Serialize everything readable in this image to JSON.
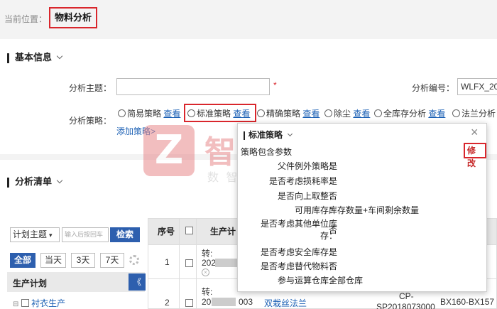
{
  "breadcrumb": {
    "prefix": "当前位置：",
    "current": "物料分析"
  },
  "basic": {
    "title": "基本信息",
    "subject_label": "分析主题：",
    "subject_required": "*",
    "code_label": "分析编号：",
    "code_value": "WLFX_20",
    "strategy_label": "分析策略：",
    "add_strategy": "添加策略>",
    "options": [
      {
        "label": "简易策略",
        "view": "查看"
      },
      {
        "label": "标准策略",
        "view": "查看"
      },
      {
        "label": "精确策略",
        "view": "查看"
      },
      {
        "label": "除尘",
        "view": "查看"
      },
      {
        "label": "全库存分析",
        "view": "查看"
      },
      {
        "label": "法兰分析",
        "view": ""
      }
    ]
  },
  "list": {
    "title": "分析清单",
    "plan_select": "计划主题",
    "plan_input_placeholder": "输入后按回车",
    "search_button": "检索",
    "filters": [
      "全部",
      "当天",
      "3天",
      "7天"
    ],
    "tree_title": "生产计划",
    "collapse_icon": "《",
    "tree_item": "衬衣生产",
    "headers": {
      "seq": "序号",
      "prod": "生产计"
    },
    "rows": [
      {
        "seq": "1",
        "line1": "转:",
        "line2": "202"
      },
      {
        "seq": "2",
        "line1": "转:",
        "line2": "20",
        "line2b": "003",
        "name": "双栽丝法兰",
        "code1": "CP-",
        "code2": "SP2018073000",
        "spec": "BX160-BX157"
      }
    ]
  },
  "popup": {
    "title": "标准策略",
    "section": "策略包含参数",
    "edit": "修改",
    "params": [
      {
        "label": "父件例外策略：",
        "value": "是"
      },
      {
        "label": "是否考虑损耗率：",
        "value": "是"
      },
      {
        "label": "是否向上取整：",
        "value": "否"
      },
      {
        "label": "可用库存：",
        "value": "库存数量+车间剩余数量"
      },
      {
        "label": "是否考虑其他单位库",
        "label2": "存：",
        "value": "否"
      },
      {
        "label": "是否考虑安全库存：",
        "value": "是"
      },
      {
        "label": "是否考虑替代物料：",
        "value": "否"
      },
      {
        "label": "参与运算仓库：",
        "value": "全部仓库"
      }
    ]
  },
  "watermark": {
    "brand": "智药国际",
    "tagline": "数 智 一 路 同 行 者",
    "logo_letter": "Z"
  },
  "colors": {
    "accent_red": "#d9262c",
    "link_blue": "#1a5fb4",
    "nav_blue": "#2d5fae",
    "popup_edit_red": "#c62828"
  }
}
